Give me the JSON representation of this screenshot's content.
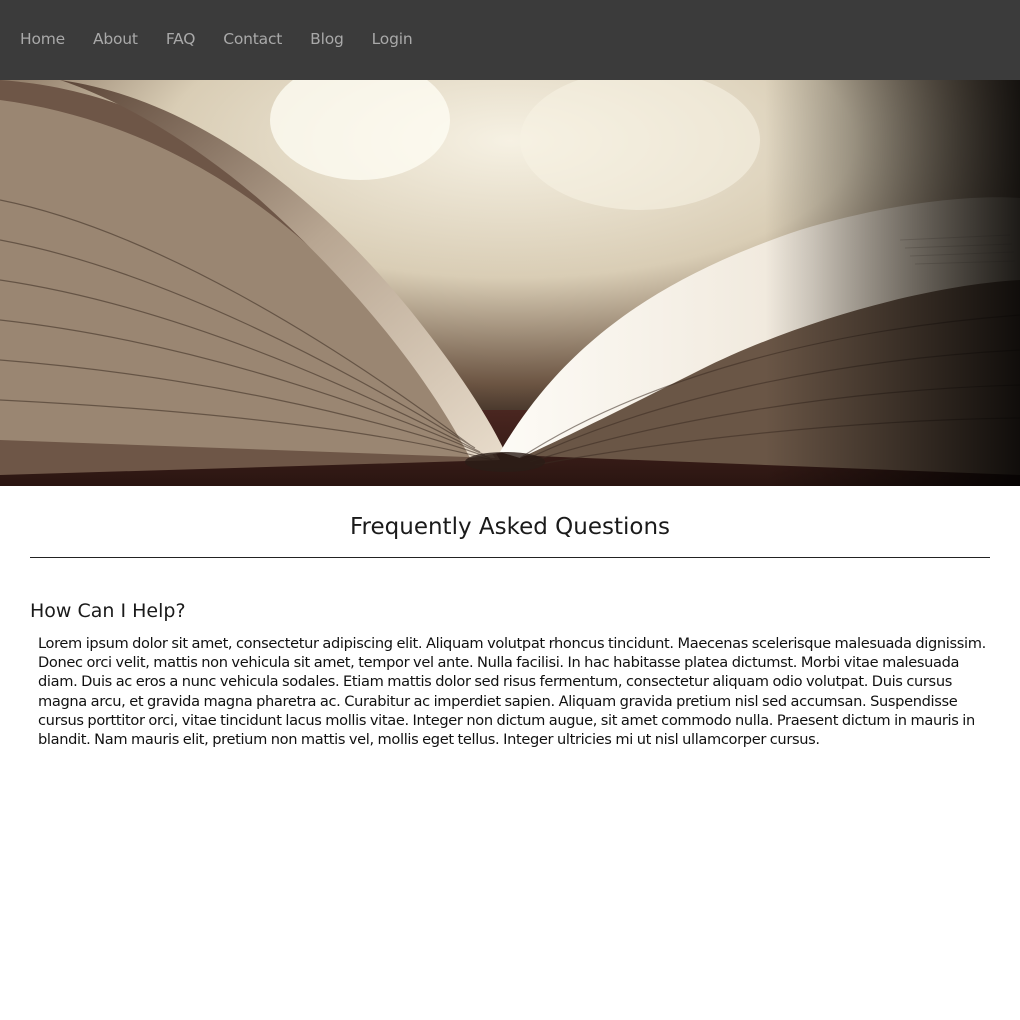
{
  "nav": {
    "items": [
      {
        "label": "Home"
      },
      {
        "label": "About"
      },
      {
        "label": "FAQ"
      },
      {
        "label": "Contact"
      },
      {
        "label": "Blog"
      },
      {
        "label": "Login"
      }
    ]
  },
  "hero": {
    "image": "open-book-photo"
  },
  "main": {
    "title": "Frequently Asked Questions",
    "section": {
      "heading": "How Can I Help?",
      "body": "Lorem ipsum dolor sit amet, consectetur adipiscing elit. Aliquam volutpat rhoncus tincidunt. Maecenas scelerisque malesuada dignissim. Donec orci velit, mattis non vehicula sit amet, tempor vel ante. Nulla facilisi. In hac habitasse platea dictumst. Morbi vitae malesuada diam. Duis ac eros a nunc vehicula sodales. Etiam mattis dolor sed risus fermentum, consectetur aliquam odio volutpat. Duis cursus magna arcu, et gravida magna pharetra ac. Curabitur ac imperdiet sapien. Aliquam gravida pretium nisl sed accumsan. Suspendisse cursus porttitor orci, vitae tincidunt lacus mollis vitae. Integer non dictum augue, sit amet commodo nulla. Praesent dictum in mauris in blandit. Nam mauris elit, pretium non mattis vel, mollis eget tellus. Integer ultricies mi ut nisl ullamcorper cursus."
    }
  },
  "colors": {
    "navbar_bg": "#3b3b3b",
    "nav_text": "#a9a9a9",
    "page_bg": "#ffffff"
  }
}
